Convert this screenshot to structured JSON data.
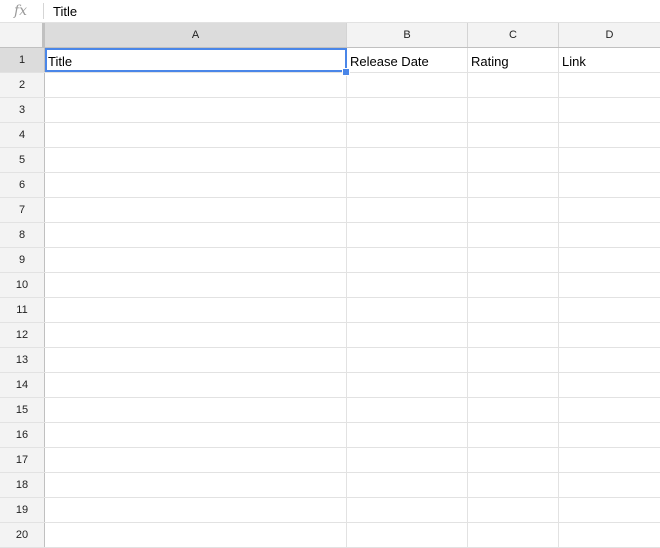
{
  "formula_bar": {
    "icon": "function-fx-icon",
    "icon_glyph": "fx",
    "value": "Title"
  },
  "columns": [
    "A",
    "B",
    "C",
    "D"
  ],
  "selected": {
    "column": "A",
    "row": "1"
  },
  "rows": [
    {
      "num": "1",
      "cells": [
        "Title",
        "Release Date",
        "Rating",
        "Link"
      ]
    },
    {
      "num": "2",
      "cells": [
        "",
        "",
        "",
        ""
      ]
    },
    {
      "num": "3",
      "cells": [
        "",
        "",
        "",
        ""
      ]
    },
    {
      "num": "4",
      "cells": [
        "",
        "",
        "",
        ""
      ]
    },
    {
      "num": "5",
      "cells": [
        "",
        "",
        "",
        ""
      ]
    },
    {
      "num": "6",
      "cells": [
        "",
        "",
        "",
        ""
      ]
    },
    {
      "num": "7",
      "cells": [
        "",
        "",
        "",
        ""
      ]
    },
    {
      "num": "8",
      "cells": [
        "",
        "",
        "",
        ""
      ]
    },
    {
      "num": "9",
      "cells": [
        "",
        "",
        "",
        ""
      ]
    },
    {
      "num": "10",
      "cells": [
        "",
        "",
        "",
        ""
      ]
    },
    {
      "num": "11",
      "cells": [
        "",
        "",
        "",
        ""
      ]
    },
    {
      "num": "12",
      "cells": [
        "",
        "",
        "",
        ""
      ]
    },
    {
      "num": "13",
      "cells": [
        "",
        "",
        "",
        ""
      ]
    },
    {
      "num": "14",
      "cells": [
        "",
        "",
        "",
        ""
      ]
    },
    {
      "num": "15",
      "cells": [
        "",
        "",
        "",
        ""
      ]
    },
    {
      "num": "16",
      "cells": [
        "",
        "",
        "",
        ""
      ]
    },
    {
      "num": "17",
      "cells": [
        "",
        "",
        "",
        ""
      ]
    },
    {
      "num": "18",
      "cells": [
        "",
        "",
        "",
        ""
      ]
    },
    {
      "num": "19",
      "cells": [
        "",
        "",
        "",
        ""
      ]
    },
    {
      "num": "20",
      "cells": [
        "",
        "",
        "",
        ""
      ]
    }
  ],
  "colors": {
    "selection": "#4a86e8",
    "header_bg": "#f3f3f3",
    "header_selected_bg": "#dcdcdc",
    "gridline": "#e2e2e2"
  }
}
